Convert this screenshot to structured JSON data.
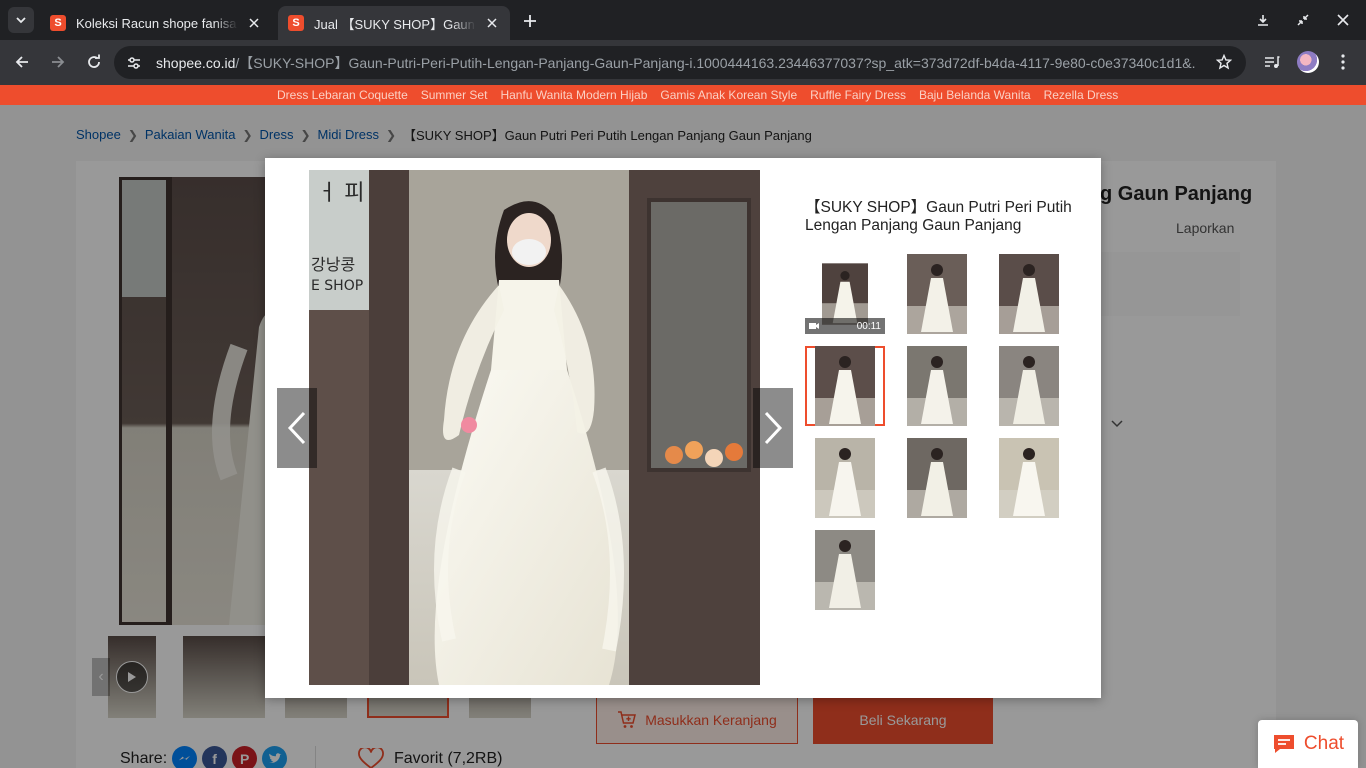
{
  "browser": {
    "tabs": [
      {
        "title": "Koleksi Racun shope fanisa, P",
        "favicon": "shopee-icon",
        "active": false
      },
      {
        "title": "Jual 【SUKY SHOP】Gaun Putri",
        "favicon": "shopee-icon",
        "active": true
      }
    ],
    "url_host": "shopee.co.id",
    "url_path": "/【SUKY-SHOP】Gaun-Putri-Peri-Putih-Lengan-Panjang-Gaun-Panjang-i.1000444163.23446377037?sp_atk=373d72df-b4da-4117-9e80-c0e37340c1d1&..."
  },
  "category_strip": [
    "Dress Lebaran Coquette",
    "Summer Set",
    "Hanfu Wanita Modern Hijab",
    "Gamis Anak Korean Style",
    "Ruffle Fairy Dress",
    "Baju Belanda Wanita",
    "Rezella Dress"
  ],
  "breadcrumb": {
    "items": [
      "Shopee",
      "Pakaian Wanita",
      "Dress",
      "Midi Dress"
    ],
    "current": "【SUKY SHOP】Gaun Putri Peri Putih Lengan Panjang Gaun Panjang"
  },
  "product": {
    "title_visible": "g Gaun Panjang",
    "report_label": "Laporkan",
    "add_to_cart_label": "Masukkan Keranjang",
    "buy_now_label": "Beli Sekarang",
    "share_label": "Share:",
    "favorite_label": "Favorit (7,2RB)"
  },
  "modal": {
    "title": "【SUKY SHOP】Gaun Putri Peri Putih Lengan Panjang Gaun Panjang",
    "video_duration": "00:11",
    "thumbnail_count": 10,
    "selected_thumbnail_index": 3
  },
  "chat": {
    "label": "Chat"
  },
  "colors": {
    "brand": "#ee4d2d",
    "link": "#0055aa"
  }
}
